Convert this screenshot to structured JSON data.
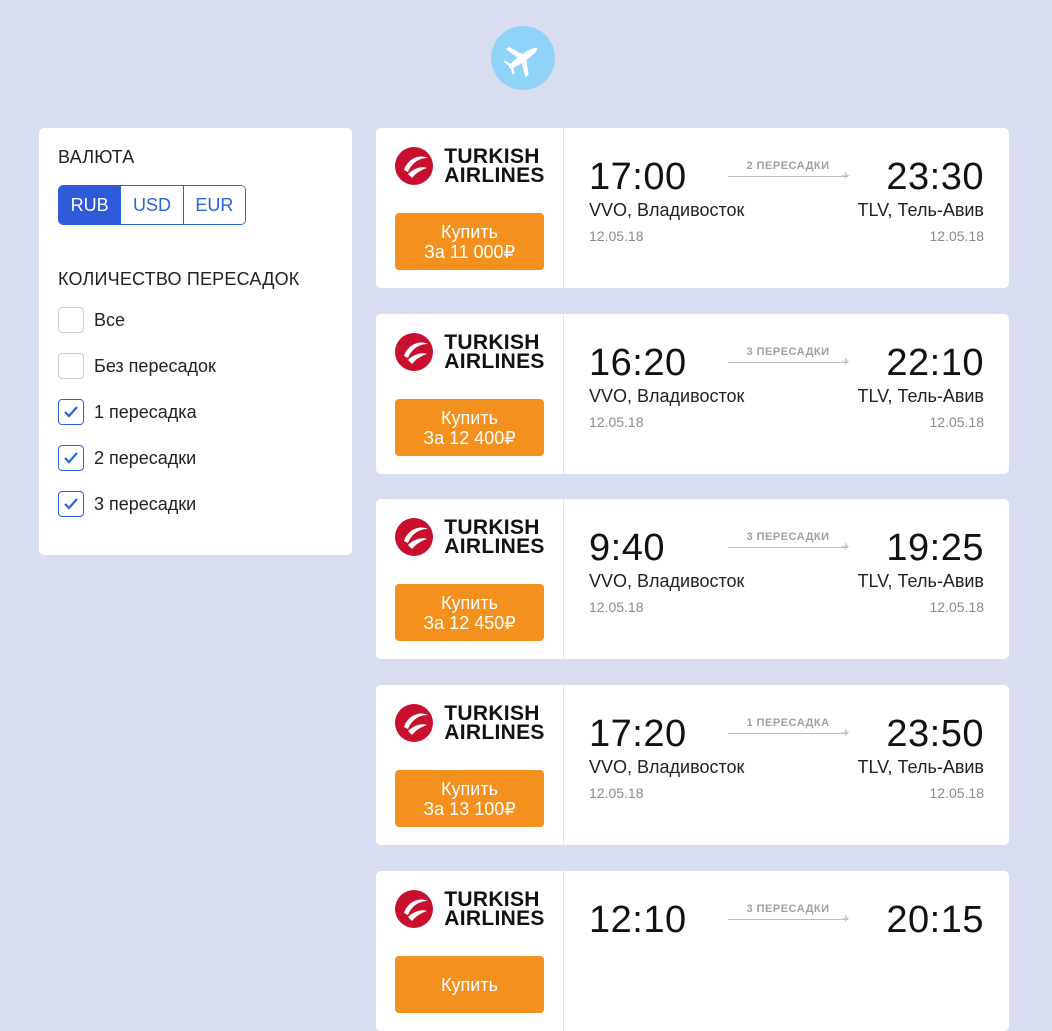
{
  "header": {
    "logo_icon": "airplane-icon"
  },
  "filters": {
    "currency_title": "ВАЛЮТА",
    "currencies": [
      {
        "label": "RUB",
        "active": true
      },
      {
        "label": "USD",
        "active": false
      },
      {
        "label": "EUR",
        "active": false
      }
    ],
    "stops_title": "КОЛИЧЕСТВО ПЕРЕСАДОК",
    "stops_options": [
      {
        "label": "Все",
        "checked": false
      },
      {
        "label": "Без пересадок",
        "checked": false
      },
      {
        "label": "1 пересадка",
        "checked": true
      },
      {
        "label": "2 пересадки",
        "checked": true
      },
      {
        "label": "3 пересадки",
        "checked": true
      }
    ]
  },
  "colors": {
    "accent": "#2e59d9",
    "buy": "#f3901e",
    "airline_red": "#c8102e",
    "background": "#d9ddf0"
  },
  "tickets": [
    {
      "airline_line1": "TURKISH",
      "airline_line2": "AIRLINES",
      "buy_label": "Купить",
      "price": "За 11 000₽",
      "dep_time": "17:00",
      "dep_city": "VVO, Владивосток",
      "dep_date": "12.05.18",
      "stops": "2 ПЕРЕСАДКИ",
      "arr_time": "23:30",
      "arr_city": "TLV, Тель-Авив",
      "arr_date": "12.05.18"
    },
    {
      "airline_line1": "TURKISH",
      "airline_line2": "AIRLINES",
      "buy_label": "Купить",
      "price": "За 12 400₽",
      "dep_time": "16:20",
      "dep_city": "VVO, Владивосток",
      "dep_date": "12.05.18",
      "stops": "3 ПЕРЕСАДКИ",
      "arr_time": "22:10",
      "arr_city": "TLV, Тель-Авив",
      "arr_date": "12.05.18"
    },
    {
      "airline_line1": "TURKISH",
      "airline_line2": "AIRLINES",
      "buy_label": "Купить",
      "price": "За 12 450₽",
      "dep_time": "9:40",
      "dep_city": "VVO, Владивосток",
      "dep_date": "12.05.18",
      "stops": "3 ПЕРЕСАДКИ",
      "arr_time": "19:25",
      "arr_city": "TLV, Тель-Авив",
      "arr_date": "12.05.18"
    },
    {
      "airline_line1": "TURKISH",
      "airline_line2": "AIRLINES",
      "buy_label": "Купить",
      "price": "За 13 100₽",
      "dep_time": "17:20",
      "dep_city": "VVO, Владивосток",
      "dep_date": "12.05.18",
      "stops": "1 ПЕРЕСАДКА",
      "arr_time": "23:50",
      "arr_city": "TLV, Тель-Авив",
      "arr_date": "12.05.18"
    },
    {
      "airline_line1": "TURKISH",
      "airline_line2": "AIRLINES",
      "buy_label": "Купить",
      "price": "",
      "dep_time": "12:10",
      "dep_city": "",
      "dep_date": "",
      "stops": "3 ПЕРЕСАДКИ",
      "arr_time": "20:15",
      "arr_city": "",
      "arr_date": ""
    }
  ]
}
